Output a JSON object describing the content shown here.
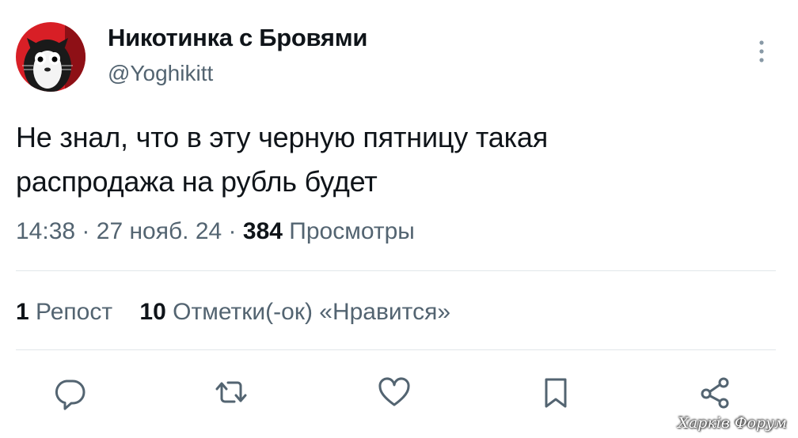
{
  "author": {
    "display_name": "Никотинка с Бровями",
    "handle": "@Yoghikitt",
    "avatar": "cat-avatar"
  },
  "tweet": {
    "text_line1": "Не знал, что в эту черную пятницу такая",
    "text_line2": "распродажа на рубль будет",
    "time": "14:38",
    "date": "27 нояб. 24",
    "separator": "·",
    "views_count": "384",
    "views_label": "Просмотры"
  },
  "stats": {
    "reposts_count": "1",
    "reposts_label": "Репост",
    "likes_count": "10",
    "likes_label": "Отметки(-ок) «Нравится»"
  },
  "actions": {
    "reply": "reply-icon",
    "repost": "repost-icon",
    "like": "heart-icon",
    "bookmark": "bookmark-icon",
    "share": "share-icon"
  },
  "watermark": "Харків Форум",
  "colors": {
    "text": "#0f1419",
    "secondary": "#536471",
    "divider": "#e1e6ea",
    "avatar_bg": "#d81f26"
  }
}
